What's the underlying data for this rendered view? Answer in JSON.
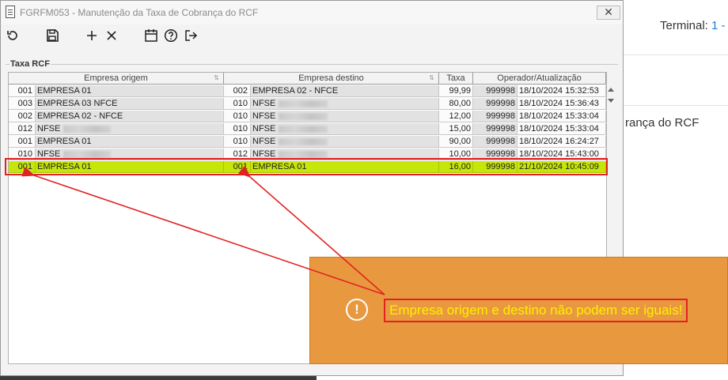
{
  "background": {
    "terminal_label": "Terminal:",
    "terminal_value": "1 -",
    "caption": "rança do RCF"
  },
  "window": {
    "title": "FGRFM053 - Manutenção da Taxa de Cobrança do RCF",
    "close_glyph": "✕"
  },
  "toolbar": {
    "icons": [
      "refresh-icon",
      "save-icon",
      "add-icon",
      "delete-icon",
      "calendar-icon",
      "help-icon",
      "exit-icon"
    ]
  },
  "group": {
    "label": "Taxa RCF"
  },
  "grid": {
    "columns": [
      "Empresa origem",
      "Empresa destino",
      "Taxa",
      "Operador/Atualização"
    ],
    "rows": [
      {
        "orig_code": "001",
        "orig_name": "EMPRESA 01",
        "dest_code": "002",
        "dest_name": "EMPRESA 02 - NFCE",
        "taxa": "99,99",
        "operador": "999998",
        "data": "18/10/2024 15:32:53",
        "orig_blur": false,
        "dest_blur": false
      },
      {
        "orig_code": "003",
        "orig_name": "EMPRESA 03 NFCE",
        "dest_code": "010",
        "dest_name": "NFSE",
        "taxa": "80,00",
        "operador": "999998",
        "data": "18/10/2024 15:36:43",
        "orig_blur": false,
        "dest_blur": true
      },
      {
        "orig_code": "002",
        "orig_name": "EMPRESA 02 - NFCE",
        "dest_code": "010",
        "dest_name": "NFSE",
        "taxa": "12,00",
        "operador": "999998",
        "data": "18/10/2024 15:33:04",
        "orig_blur": false,
        "dest_blur": true
      },
      {
        "orig_code": "012",
        "orig_name": "NFSE",
        "dest_code": "010",
        "dest_name": "NFSE",
        "taxa": "15,00",
        "operador": "999998",
        "data": "18/10/2024 15:33:04",
        "orig_blur": true,
        "dest_blur": true
      },
      {
        "orig_code": "001",
        "orig_name": "EMPRESA 01",
        "dest_code": "010",
        "dest_name": "NFSE",
        "taxa": "90,00",
        "operador": "999998",
        "data": "18/10/2024 16:24:27",
        "orig_blur": false,
        "dest_blur": true
      },
      {
        "orig_code": "010",
        "orig_name": "NFSE",
        "dest_code": "012",
        "dest_name": "NFSE",
        "taxa": "10,00",
        "operador": "999998",
        "data": "18/10/2024 15:43:00",
        "orig_blur": true,
        "dest_blur": true
      },
      {
        "orig_code": "001",
        "orig_name": "EMPRESA 01",
        "dest_code": "001",
        "dest_name": "EMPRESA 01",
        "taxa": "16,00",
        "operador": "999998",
        "data": "21/10/2024 10:45:09",
        "orig_blur": false,
        "dest_blur": false,
        "selected": true
      }
    ]
  },
  "toast": {
    "icon": "!",
    "message": "Empresa origem e destino não podem ser iguais!",
    "background_color": "#e8993f",
    "message_color": "#ffee00"
  },
  "colors": {
    "selected_row": "#c6e60a",
    "highlight_red": "#e22222"
  }
}
